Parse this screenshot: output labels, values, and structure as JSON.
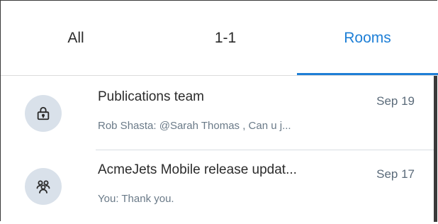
{
  "tabs": [
    {
      "label": "All"
    },
    {
      "label": "1-1"
    },
    {
      "label": "Rooms",
      "active": true
    }
  ],
  "accent_color": "#1e7fd6",
  "rooms": [
    {
      "icon": "lock-icon",
      "name": "Publications team",
      "date": "Sep 19",
      "preview": "Rob Shasta: @Sarah Thomas , Can u j..."
    },
    {
      "icon": "people-group-icon",
      "name": "AcmeJets Mobile release updat...",
      "date": "Sep 17",
      "preview": "You: Thank you."
    }
  ]
}
